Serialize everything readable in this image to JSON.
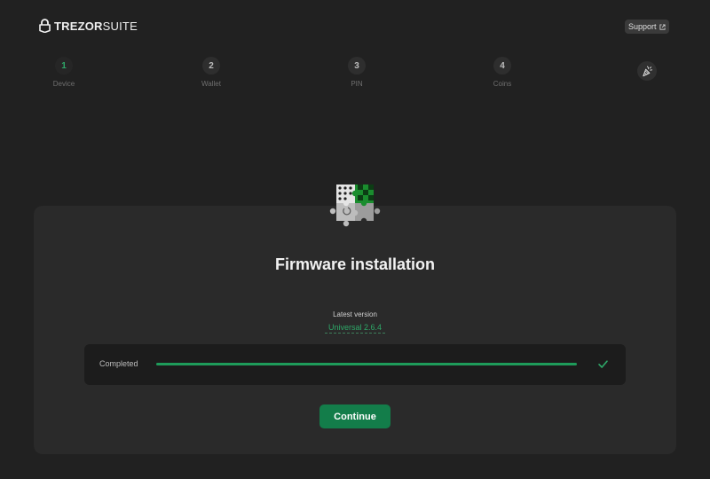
{
  "header": {
    "brand_primary": "TREZOR",
    "brand_secondary": "SUITE",
    "logo_icon": "lock-icon",
    "support_label": "Support",
    "support_icon": "external-link-icon"
  },
  "steps": [
    {
      "number": "1",
      "label": "Device",
      "active": true
    },
    {
      "number": "2",
      "label": "Wallet",
      "active": false
    },
    {
      "number": "3",
      "label": "PIN",
      "active": false
    },
    {
      "number": "4",
      "label": "Coins",
      "active": false
    }
  ],
  "finish_step_icon": "party-popper-icon",
  "card": {
    "illustration": "puzzle-icon",
    "title": "Firmware installation",
    "version_label": "Latest version",
    "version_value": "Universal 2.6.4",
    "progress_status": "Completed",
    "progress_fraction": 1.0,
    "check_icon": "check-icon",
    "continue_label": "Continue"
  },
  "colors": {
    "background": "#212121",
    "card": "#2a2a2a",
    "accent": "#2ea868",
    "button": "#137d4a",
    "progress": "#1e9b5a"
  }
}
